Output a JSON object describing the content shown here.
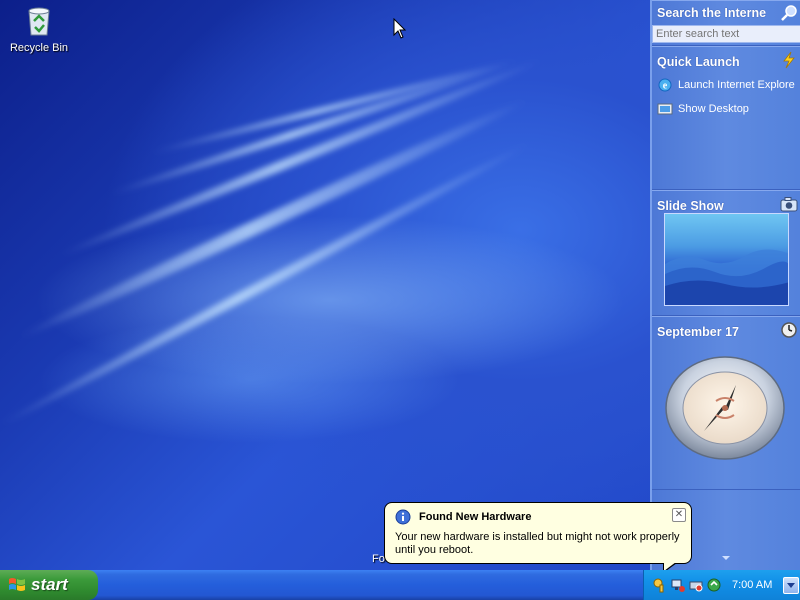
{
  "desktop": {
    "icons": [
      {
        "label": "Recycle Bin",
        "icon": "recycle-bin-icon"
      }
    ],
    "hidden_text": "Fo"
  },
  "sidebar": {
    "search": {
      "title": "Search the Interne",
      "placeholder": "Enter search text",
      "icon": "search-icon"
    },
    "quick_launch": {
      "title": "Quick Launch",
      "icon": "lightning-icon",
      "items": [
        {
          "label": "Launch Internet Explore",
          "icon": "internet-explorer-icon"
        },
        {
          "label": "Show Desktop",
          "icon": "show-desktop-icon"
        }
      ]
    },
    "slide_show": {
      "title": "Slide Show",
      "icon": "camera-icon"
    },
    "calendar": {
      "title": "September 17",
      "icon": "clock-icon"
    }
  },
  "balloon": {
    "title": "Found New Hardware",
    "message": "Your new hardware is installed but might not work properly until you reboot.",
    "close": "✕",
    "icon": "info-icon"
  },
  "taskbar": {
    "start_label": "start",
    "clock": "7:00 AM",
    "tray_icons": [
      "security-icon",
      "network-icon",
      "hardware-icon",
      "update-icon"
    ]
  },
  "colors": {
    "taskbar_blue": "#245edb",
    "start_green": "#3c9b3b",
    "tray_blue": "#1290e8",
    "balloon_bg": "#ffffe1"
  }
}
